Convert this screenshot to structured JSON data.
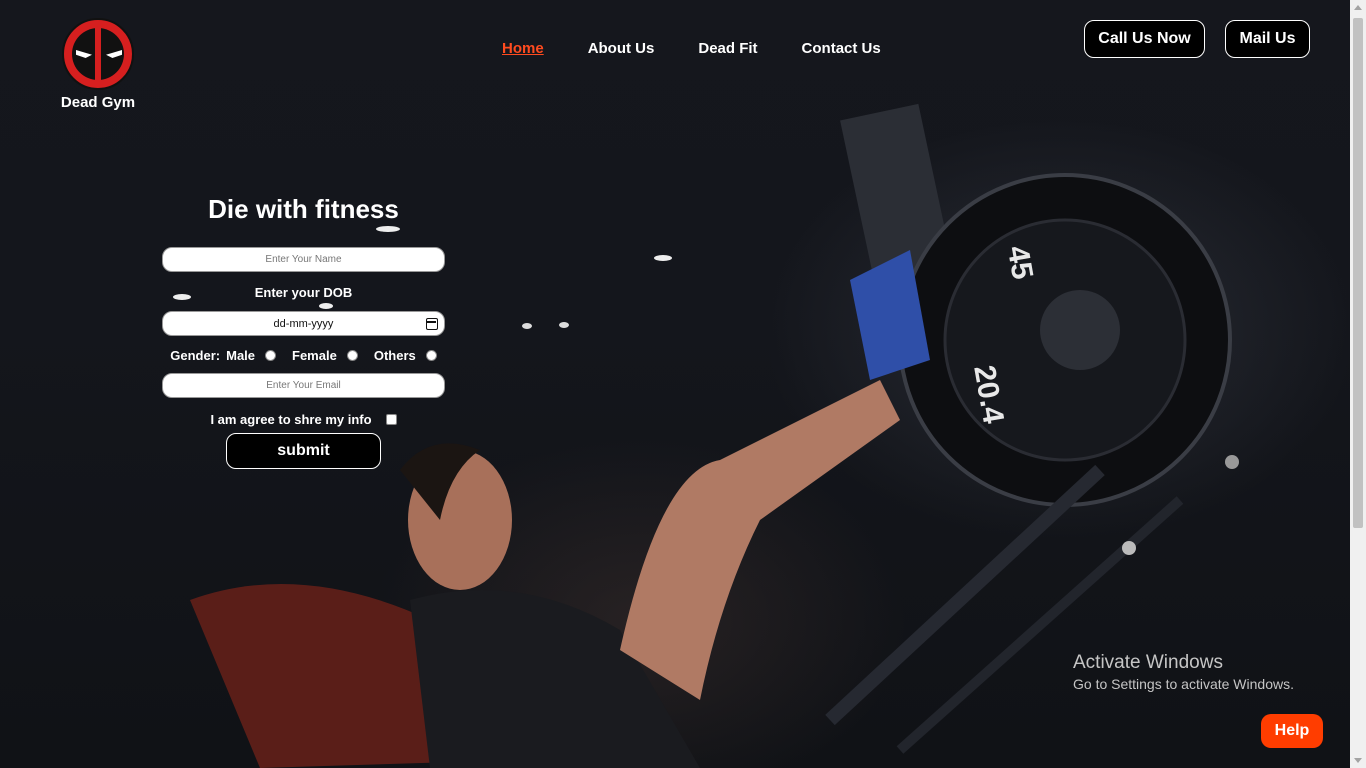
{
  "brand": {
    "name": "Dead Gym"
  },
  "nav": {
    "items": [
      {
        "label": "Home",
        "active": true
      },
      {
        "label": "About Us",
        "active": false
      },
      {
        "label": "Dead Fit",
        "active": false
      },
      {
        "label": "Contact Us",
        "active": false
      }
    ]
  },
  "header_actions": {
    "call_label": "Call Us Now",
    "mail_label": "Mail Us"
  },
  "form": {
    "title": "Die with fitness",
    "name_placeholder": "Enter Your Name",
    "dob_label": "Enter your DOB",
    "dob_placeholder": "dd-mm-yyyy",
    "gender_label": "Gender:",
    "gender_options": [
      "Male",
      "Female",
      "Others"
    ],
    "email_placeholder": "Enter Your Email",
    "agree_label": "I am agree to shre my info",
    "submit_label": "submit"
  },
  "watermark": {
    "title": "Activate Windows",
    "subtitle": "Go to Settings to activate Windows."
  },
  "help_label": "Help",
  "colors": {
    "accent": "#ff4b1f",
    "help_bg": "#ff3d00",
    "logo_red": "#d61f1f",
    "background": "#12141a"
  },
  "plate_numbers": [
    "45",
    "20.4"
  ]
}
